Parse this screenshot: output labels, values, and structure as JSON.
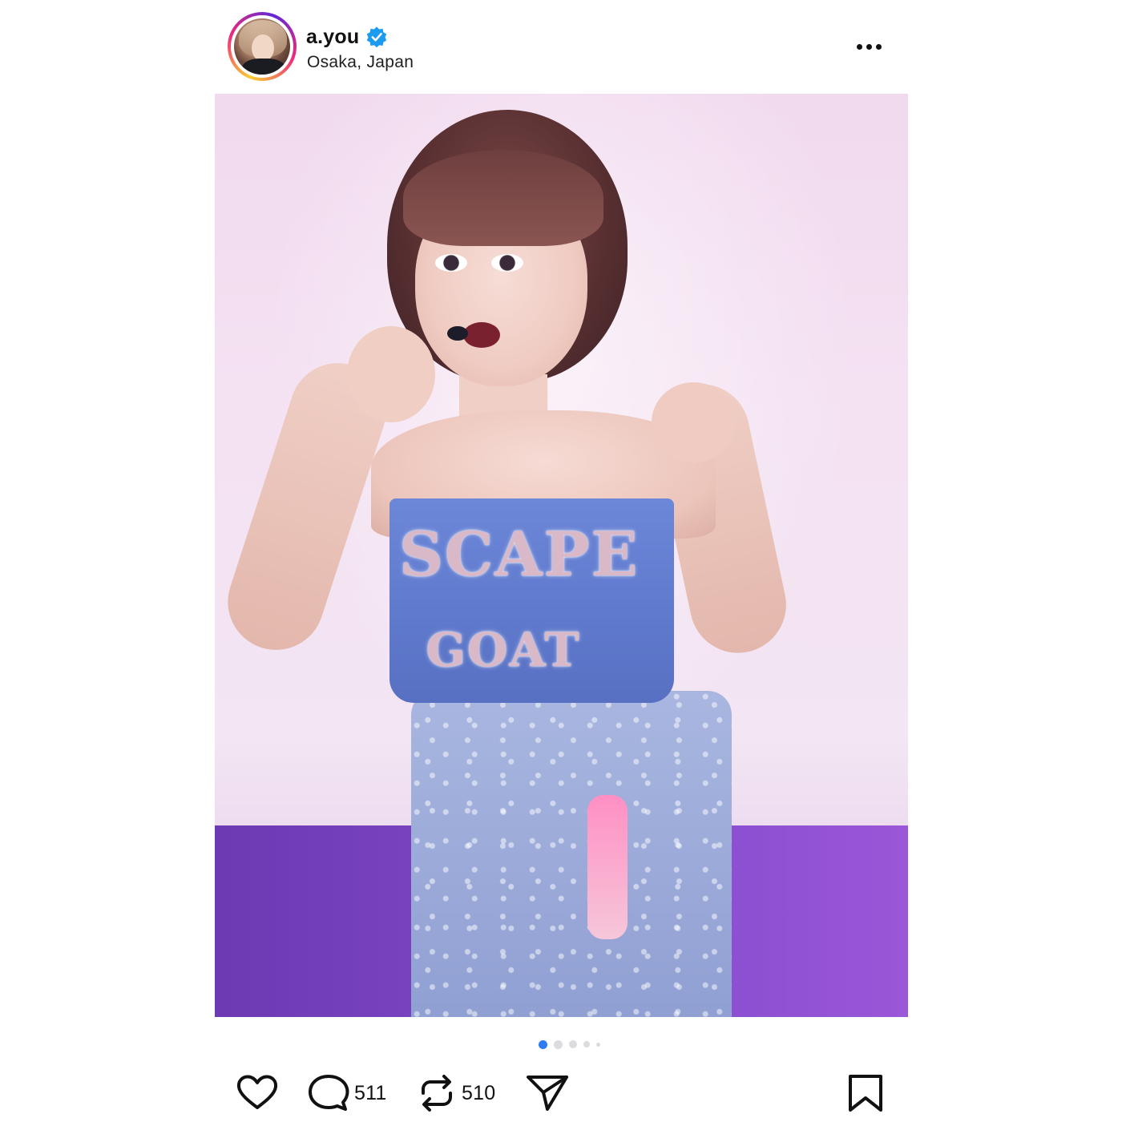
{
  "post": {
    "username": "a.you",
    "verified": true,
    "location": "Osaka, Japan",
    "photo": {
      "image_text_line1": "SCAPE",
      "image_text_line2": "GOAT"
    },
    "carousel": {
      "count": 5,
      "active_index": 0
    },
    "actions": {
      "like_icon": "heart-icon",
      "comment_icon": "comment-icon",
      "comments_count": "511",
      "repost_icon": "repost-icon",
      "reposts_count": "510",
      "share_icon": "send-icon",
      "save_icon": "bookmark-icon"
    }
  },
  "colors": {
    "verified_badge": "#1d9bf0",
    "carousel_active": "#2f7bf5",
    "carousel_inactive": "#dadce0",
    "stage_floor": "#7d45c4"
  }
}
